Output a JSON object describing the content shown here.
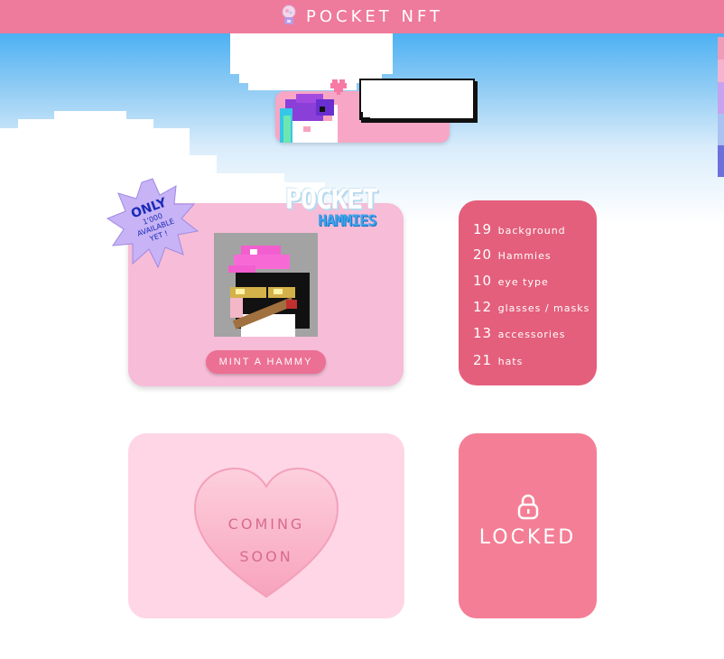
{
  "header": {
    "title": "POCKET NFT",
    "icon": "gumball-machine-icon",
    "color": "#ee7a9c"
  },
  "hero": {
    "speech_text": ""
  },
  "mint": {
    "logo_line1": "POCKET",
    "logo_line2": "HAMMIES",
    "badge": {
      "only": "ONLY",
      "line1": "1'000",
      "line2": "AVAILABLE",
      "line3": "YET !"
    },
    "button_label": "MINT A HAMMY"
  },
  "traits": [
    {
      "count": "19",
      "label": "background"
    },
    {
      "count": "20",
      "label": "Hammies"
    },
    {
      "count": "10",
      "label": "eye type"
    },
    {
      "count": "12",
      "label": "glasses / masks"
    },
    {
      "count": "13",
      "label": "accessories"
    },
    {
      "count": "21",
      "label": "hats"
    }
  ],
  "coming_soon": {
    "line1": "COMING",
    "line2": "SOON"
  },
  "locked": {
    "label": "LOCKED",
    "icon": "lock-icon"
  },
  "colors": {
    "accent": "#ee7a9c",
    "traits_bg": "#e45f7c",
    "locked_bg": "#f47e95",
    "mint_bg": "#f7bcd7",
    "soon_bg": "#fed6e5"
  }
}
